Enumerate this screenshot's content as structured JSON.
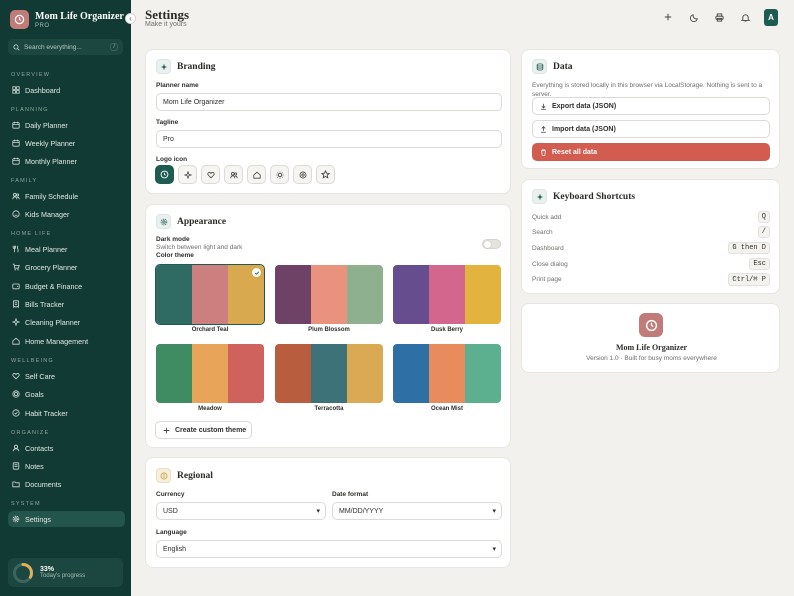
{
  "app": {
    "name": "Mom Life Organizer",
    "plan": "PRO"
  },
  "search": {
    "placeholder": "Search everything...",
    "shortcut": "/"
  },
  "sidebar": {
    "sections": [
      {
        "title": "OVERVIEW"
      },
      {
        "title": "PLANNING"
      },
      {
        "title": "FAMILY"
      },
      {
        "title": "HOME LIFE"
      },
      {
        "title": "WELLBEING"
      },
      {
        "title": "ORGANIZE"
      },
      {
        "title": "SYSTEM"
      }
    ],
    "items": [
      {
        "label": "Dashboard",
        "icon": "home-grid-icon"
      },
      {
        "label": "Daily Planner",
        "icon": "calendar-icon"
      },
      {
        "label": "Weekly Planner",
        "icon": "calendar-week-icon"
      },
      {
        "label": "Monthly Planner",
        "icon": "calendar-month-icon"
      },
      {
        "label": "Family Schedule",
        "icon": "users-icon"
      },
      {
        "label": "Kids Manager",
        "icon": "smile-icon"
      },
      {
        "label": "Meal Planner",
        "icon": "utensils-icon"
      },
      {
        "label": "Grocery Planner",
        "icon": "cart-icon"
      },
      {
        "label": "Budget & Finance",
        "icon": "wallet-icon"
      },
      {
        "label": "Bills Tracker",
        "icon": "receipt-icon"
      },
      {
        "label": "Cleaning Planner",
        "icon": "sparkle-icon"
      },
      {
        "label": "Home Management",
        "icon": "house-icon"
      },
      {
        "label": "Self Care",
        "icon": "heart-icon"
      },
      {
        "label": "Goals",
        "icon": "target-icon"
      },
      {
        "label": "Habit Tracker",
        "icon": "check-circle-icon"
      },
      {
        "label": "Contacts",
        "icon": "contact-icon"
      },
      {
        "label": "Notes",
        "icon": "note-icon"
      },
      {
        "label": "Documents",
        "icon": "folder-icon"
      },
      {
        "label": "Settings",
        "icon": "gear-icon"
      }
    ],
    "progress": {
      "percent": "33%",
      "value": 0.33,
      "label": "Today's progress"
    }
  },
  "header": {
    "title": "Settings",
    "subtitle": "Make it yours",
    "avatar": "A"
  },
  "branding": {
    "title": "Branding",
    "planner_name_label": "Planner name",
    "planner_name": "Mom Life Organizer",
    "tagline_label": "Tagline",
    "tagline": "Pro",
    "logo_icon_label": "Logo icon"
  },
  "appearance": {
    "title": "Appearance",
    "dark_mode_label": "Dark mode",
    "dark_mode_desc": "Switch between light and dark",
    "color_theme_label": "Color theme",
    "themes": [
      {
        "name": "Orchard Teal",
        "colors": [
          "#2f6b63",
          "#cb7f7f",
          "#d9a94f"
        ],
        "selected": true
      },
      {
        "name": "Plum Blossom",
        "colors": [
          "#6e4166",
          "#e9937e",
          "#8fb08e"
        ],
        "selected": false
      },
      {
        "name": "Dusk Berry",
        "colors": [
          "#654d8e",
          "#d2668c",
          "#e3b43d"
        ],
        "selected": false
      },
      {
        "name": "Meadow",
        "colors": [
          "#3f8b62",
          "#e8a55a",
          "#cf625c"
        ],
        "selected": false
      },
      {
        "name": "Terracotta",
        "colors": [
          "#b85d3e",
          "#3d7378",
          "#d9a954"
        ],
        "selected": false
      },
      {
        "name": "Ocean Mist",
        "colors": [
          "#2e6fa5",
          "#e88b5d",
          "#5cb08f"
        ],
        "selected": false
      }
    ],
    "custom_button": "Create custom theme"
  },
  "regional": {
    "title": "Regional",
    "currency_label": "Currency",
    "currency": "USD",
    "date_format_label": "Date format",
    "date_format": "MM/DD/YYYY",
    "language_label": "Language",
    "language": "English"
  },
  "data_section": {
    "title": "Data",
    "description": "Everything is stored locally in this browser via LocalStorage. Nothing is sent to a server.",
    "export": "Export data (JSON)",
    "import": "Import data (JSON)",
    "reset": "Reset all data"
  },
  "shortcuts": {
    "title": "Keyboard Shortcuts",
    "rows": [
      {
        "label": "Quick add",
        "key": "Q"
      },
      {
        "label": "Search",
        "key": "/"
      },
      {
        "label": "Dashboard",
        "key": "G then D"
      },
      {
        "label": "Close dialog",
        "key": "Esc"
      },
      {
        "label": "Print page",
        "key": "Ctrl/⌘ P"
      }
    ]
  },
  "about": {
    "name": "Mom Life Organizer",
    "version": "Version 1.0 · Built for busy moms everywhere"
  }
}
